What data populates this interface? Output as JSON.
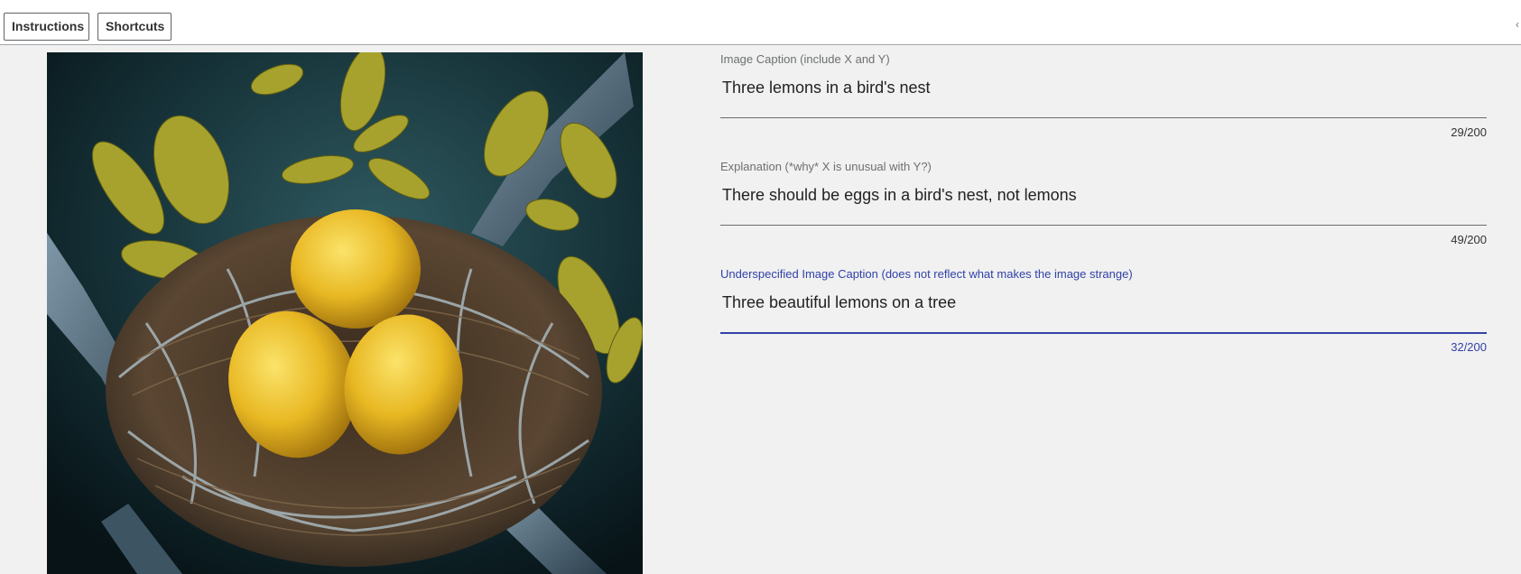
{
  "toolbar": {
    "instructions_label": "Instructions",
    "shortcuts_label": "Shortcuts"
  },
  "image": {
    "subject": "three lemons in a bird's nest on a branch"
  },
  "form": {
    "fields": [
      {
        "label": "Image Caption (include X and Y)",
        "value": "Three lemons in a bird's nest",
        "counter": "29/200",
        "focused": false
      },
      {
        "label": "Explanation (*why* X is unusual with Y?)",
        "value": "There should be eggs in a bird's nest, not lemons",
        "counter": "49/200",
        "focused": false
      },
      {
        "label": "Underspecified Image Caption (does not reflect what makes the image strange)",
        "value": "Three beautiful lemons on a tree",
        "counter": "32/200",
        "focused": true
      }
    ]
  },
  "colors": {
    "accent": "#3341a8",
    "background": "#f0f1f0",
    "underline": "#6b6b6b"
  }
}
